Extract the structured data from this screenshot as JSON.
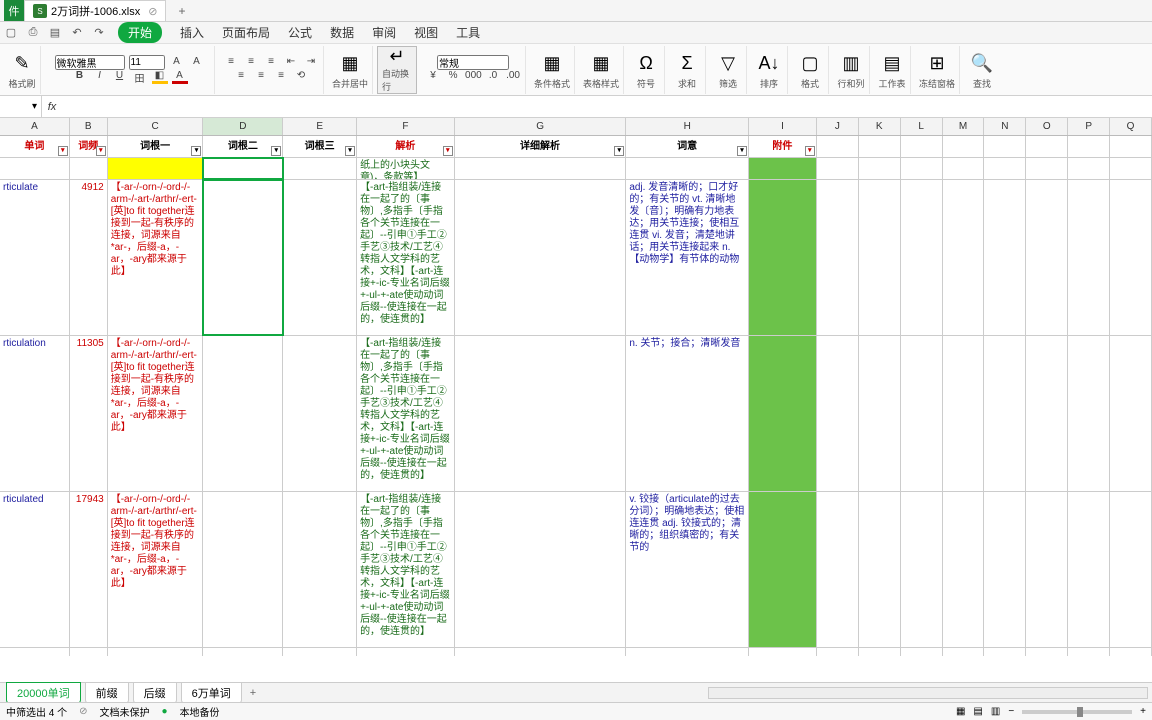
{
  "file_tab": "2万词拼-1006.xlsx",
  "menu": {
    "start": "开始",
    "insert": "插入",
    "pagelayout": "页面布局",
    "formulas": "公式",
    "data": "数据",
    "review": "审阅",
    "view": "视图",
    "tools": "工具"
  },
  "ribbon": {
    "format_brush": "格式刷",
    "font_name": "微软雅黑",
    "font_size": "11",
    "number_format": "常规",
    "merge": "合并居中",
    "autowrap": "自动换行",
    "conditional": "条件格式",
    "table_style": "表格样式",
    "symbol": "符号",
    "sum": "求和",
    "filter": "筛选",
    "sort": "排序",
    "format": "格式",
    "row_col": "行和列",
    "worksheet": "工作表",
    "freeze": "冻结窗格",
    "find": "查找"
  },
  "cols": [
    "A",
    "B",
    "C",
    "D",
    "E",
    "F",
    "G",
    "H",
    "I",
    "J",
    "K",
    "L",
    "M",
    "N",
    "O",
    "P",
    "Q"
  ],
  "headers": {
    "A": "单词",
    "B": "词频",
    "C": "词根一",
    "D": "词根二",
    "E": "词根三",
    "F": "解析",
    "G": "详细解析",
    "H": "词意",
    "I": "附件"
  },
  "rows": [
    {
      "A": "rticulate",
      "B": "4912",
      "C": "【-ar-/-orn-/-ord-/-arm-/-art-/arthr/-ert-[英]to fit together连接到一起-有秩序的连接，词源来自*ar-，后缀-a，-ar，-ary都来源于此】",
      "F_pre": "纸上的小块头文章)，条款等】",
      "F": "【-art-指组装/连接在一起了的〔事物〕,多指手〔手指各个关节连接在一起〕--引申①手工②手艺③技术/工艺④转指人文学科的艺术，文科】【-art-连接+-ic-专业名词后缀+-ul-+-ate使动动词后缀--使连接在一起的，使连贯的】",
      "H": "adj. 发音清晰的；口才好的；有关节的 vt. 清晰地发〔音〕；明确有力地表达；用关节连接；使相互连贯 vi. 发音；清楚地讲话；用关节连接起来 n.【动物学】有节体的动物"
    },
    {
      "A": "rticulation",
      "B": "11305",
      "C": "【-ar-/-orn-/-ord-/-arm-/-art-/arthr/-ert-[英]to fit together连接到一起-有秩序的连接，词源来自*ar-，后缀-a，-ar，-ary都来源于此】",
      "F": "【-art-指组装/连接在一起了的〔事物〕,多指手〔手指各个关节连接在一起〕--引申①手工②手艺③技术/工艺④转指人文学科的艺术，文科】【-art-连接+-ic-专业名词后缀+-ul-+-ate使动动词后缀--使连接在一起的，使连贯的】",
      "H": "n. 关节；接合；清晰发音"
    },
    {
      "A": "rticulated",
      "B": "17943",
      "C": "【-ar-/-orn-/-ord-/-arm-/-art-/arthr/-ert-[英]to fit together连接到一起-有秩序的连接，词源来自*ar-，后缀-a，-ar，-ary都来源于此】",
      "F": "【-art-指组装/连接在一起了的〔事物〕,多指手〔手指各个关节连接在一起〕--引申①手工②手艺③技术/工艺④转指人文学科的艺术，文科】【-art-连接+-ic-专业名词后缀+-ul-+-ate使动动词后缀--使连接在一起的，使连贯的】",
      "H": "v. 铰接（articulate的过去分词）；明确地表达；使相连连贯 adj. 铰接式的；清晰的；组织缜密的；有关节的"
    }
  ],
  "sheets": [
    "20000单词",
    "前缀",
    "后缀",
    "6万单词"
  ],
  "status": {
    "count": "中筛选出 4 个",
    "protect": "文档未保护",
    "backup": "本地备份"
  }
}
